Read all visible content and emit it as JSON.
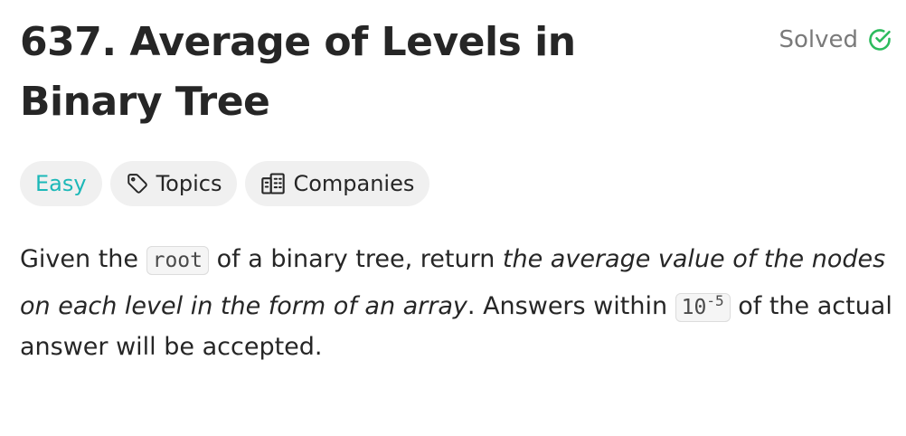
{
  "problem": {
    "title": "637. Average of Levels in Binary Tree",
    "status": "Solved",
    "status_color": "#2cbb5d"
  },
  "tags": {
    "difficulty": "Easy",
    "difficulty_color": "#1cb8b8",
    "topics_label": "Topics",
    "companies_label": "Companies"
  },
  "description": {
    "p1": "Given the ",
    "code_root": "root",
    "p2": " of a binary tree, return ",
    "em": "the average value of the nodes on each level in the form of an array",
    "p3": ". Answers within ",
    "code_base": "10",
    "code_exp": "-5",
    "p4": " of the actual answer will be accepted."
  }
}
